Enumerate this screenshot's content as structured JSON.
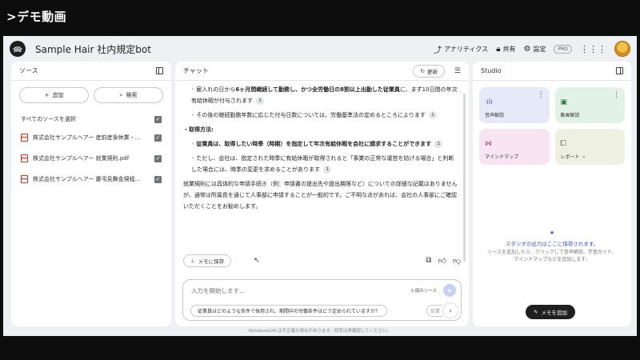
{
  "video_title": ">デモ動画",
  "header": {
    "app_title": "Sample Hair 社内規定bot",
    "analytics_label": "アナリティクス",
    "share_label": "共有",
    "settings_label": "設定",
    "pro_badge": "PRO"
  },
  "sources": {
    "title": "ソース",
    "add_label": "追加",
    "search_label": "検索",
    "select_all_label": "すべてのソースを選択",
    "items": [
      {
        "name": "株式会社サンプルヘアー 産前産後休業・..."
      },
      {
        "name": "株式会社サンプルヘアー 就業規則.pdf"
      },
      {
        "name": "株式会社サンプルヘアー 慶弔見舞金規程..."
      }
    ]
  },
  "chat": {
    "title": "チャット",
    "refresh_label": "更新",
    "p1_pre": "◦ 雇入れの日から",
    "p1_bold": "6ヶ月間継続して勤務し、かつ全労働日の8割以上出勤した従業員",
    "p1_post": "に、まず10日間の年次有給休暇が付与されます",
    "p1_cite": "1",
    "p2": "◦ その後の継続勤務年数に応じた付与日数については、労働基準法の定めるところによります",
    "p2_cite": "1",
    "heading": "・取得方法:",
    "p3_pre": "◦ ",
    "p3_bold": "従業員は、取得したい時季（時期）を指定して年次有給休暇を会社に請求することができます",
    "p3_cite": "1",
    "p4": "◦ ただし、会社は、指定された時季に有給休暇が取得されると「事業の正常な運営を妨げる場合」と判断した場合には、時季の変更を求めることがあります",
    "p4_cite": "1",
    "p5": "就業規則には具体的な申請手続き（例：申請書の提出先や提出期限など）についての詳細な記載はありませんが、通常は所属長を通じて人事部に申請することが一般的です。ご不明な点があれば、会社の人事部にご確認いただくことをお勧めします。",
    "save_memo_label": "メモに保存",
    "input_placeholder": "入力を開始します...",
    "source_count": "3 個のソース",
    "suggestion": "従業員はどのような条件で採用され、期間中の労働条件はどう定められていますか？",
    "suggestion2": "従業"
  },
  "studio": {
    "title": "Studio",
    "tiles": [
      {
        "label": "音声解説"
      },
      {
        "label": "動画解説"
      },
      {
        "label": "マインドマップ"
      },
      {
        "label": "レポート"
      }
    ],
    "empty_title": "スタジオの出力はここに保存されます。",
    "empty_sub": "ソースを追加したら、クリックして音声解説、学習ガイド、マインドマップなどを追加します。",
    "add_memo_label": "メモを追加"
  },
  "footer_note": "NotebookLM は不正確な場合があります。回答は再確認してください。",
  "colors": {
    "background": "#0d0d0d",
    "app_bg": "#eef0f3",
    "accent": "#3c4dcf",
    "send_button": "#c6d2f5"
  }
}
